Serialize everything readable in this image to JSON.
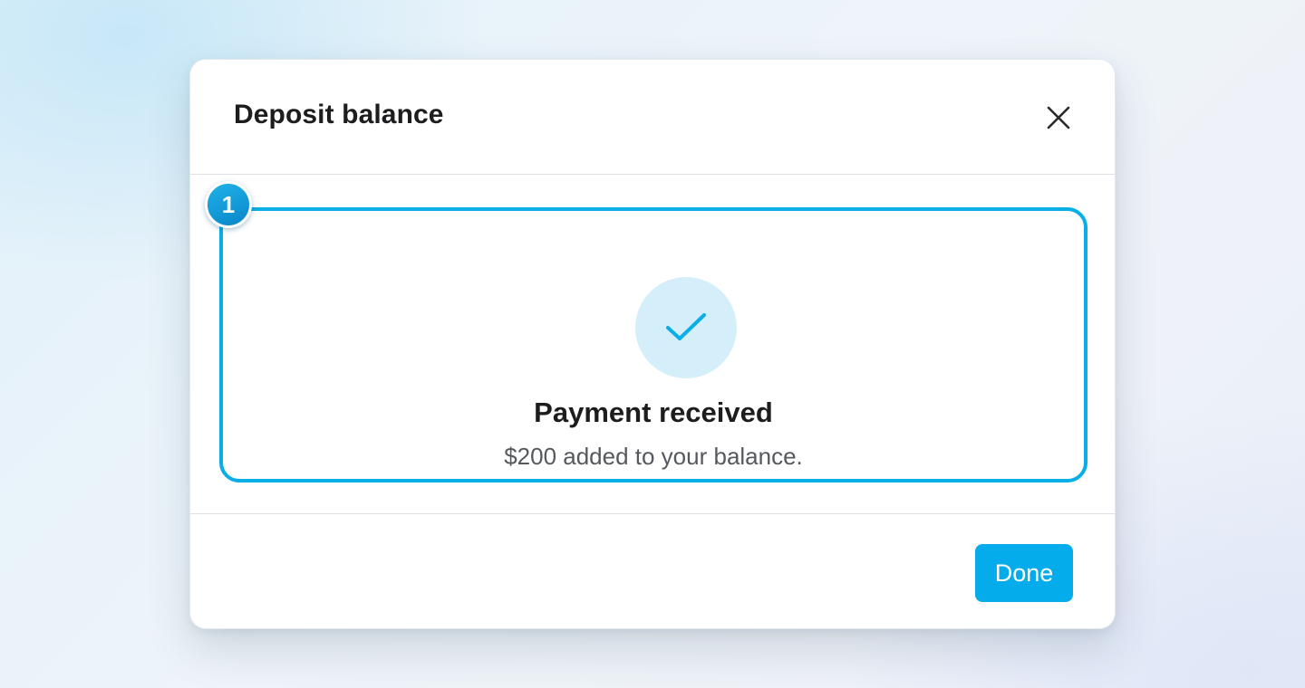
{
  "modal": {
    "title": "Deposit balance",
    "close_icon": "close-icon",
    "step_badge": "1",
    "success_icon": "check-icon",
    "success_title": "Payment received",
    "success_message": "$200 added to your balance.",
    "done_label": "Done"
  },
  "colors": {
    "accent": "#05aceb",
    "card_border": "#0aaee6",
    "check_bg": "#d5effa",
    "title_text": "#1d1d1f",
    "body_text": "#55595e"
  }
}
